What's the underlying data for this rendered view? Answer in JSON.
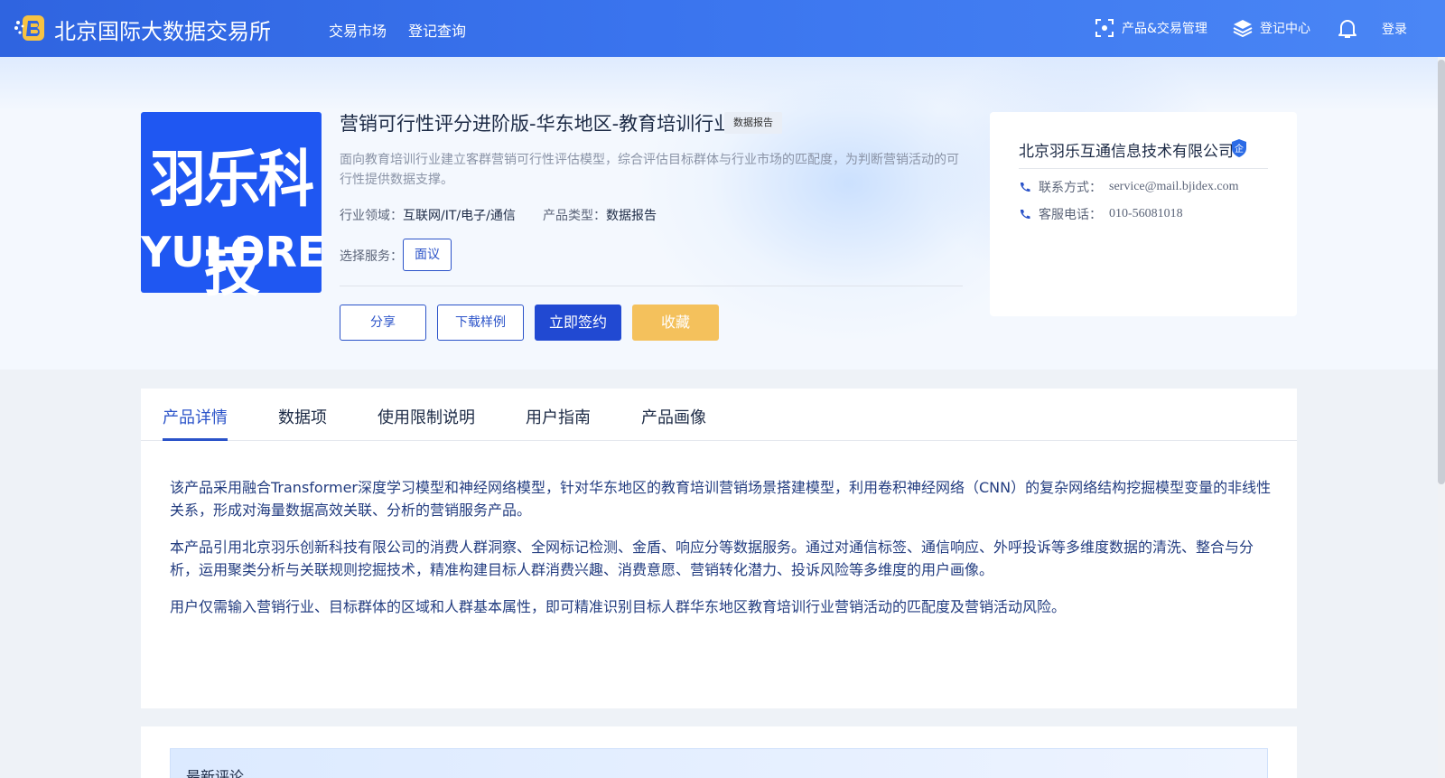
{
  "header": {
    "brand": "北京国际大数据交易所",
    "nav": [
      "交易市场",
      "登记查询"
    ],
    "product_trade_mgmt": "产品&交易管理",
    "register_center": "登记中心",
    "login": "登录"
  },
  "product": {
    "logo_cn": "羽乐科技",
    "logo_en": "YULORE",
    "title": "营销可行性评分进阶版-华东地区-教育培训行业",
    "tag": "数据报告",
    "description": "面向教育培训行业建立客群营销可行性评估模型，综合评估目标群体与行业市场的匹配度，为判断营销活动的可行性提供数据支撑。",
    "industry_label": "行业领域：",
    "industry_value": "互联网/IT/电子/通信",
    "type_label": "产品类型：",
    "type_value": "数据报告",
    "service_label": "选择服务：",
    "service_option": "面议",
    "actions": {
      "share": "分享",
      "download": "下载样例",
      "sign": "立即签约",
      "favorite": "收藏"
    }
  },
  "company": {
    "name": "北京羽乐互通信息技术有限公司",
    "badge": "企",
    "contact_label": "联系方式：",
    "contact_value": "service@mail.bjidex.com",
    "phone_label": "客服电话：",
    "phone_value": "010-56081018"
  },
  "tabs": [
    "产品详情",
    "数据项",
    "使用限制说明",
    "用户指南",
    "产品画像"
  ],
  "active_tab": "产品详情",
  "details": [
    "该产品采用融合Transformer深度学习模型和神经网络模型，针对华东地区的教育培训营销场景搭建模型，利用卷积神经网络（CNN）的复杂网络结构挖掘模型变量的非线性关系，形成对海量数据高效关联、分析的营销服务产品。",
    "本产品引用北京羽乐创新科技有限公司的消费人群洞察、全网标记检测、金盾、响应分等数据服务。通过对通信标签、通信响应、外呼投诉等多维度数据的清洗、整合与分析，运用聚类分析与关联规则挖掘技术，精准构建目标人群消费兴趣、消费意愿、营销转化潜力、投诉风险等多维度的用户画像。",
    "用户仅需输入营销行业、目标群体的区域和人群基本属性，即可精准识别目标人群华东地区教育培训行业营销活动的匹配度及营销活动风险。"
  ],
  "comments": {
    "title": "最新评论"
  },
  "colors": {
    "header": "#3a74ee",
    "primary": "#2149d2",
    "favorite": "#f4c15c",
    "logo_bg": "#1f57f2"
  }
}
